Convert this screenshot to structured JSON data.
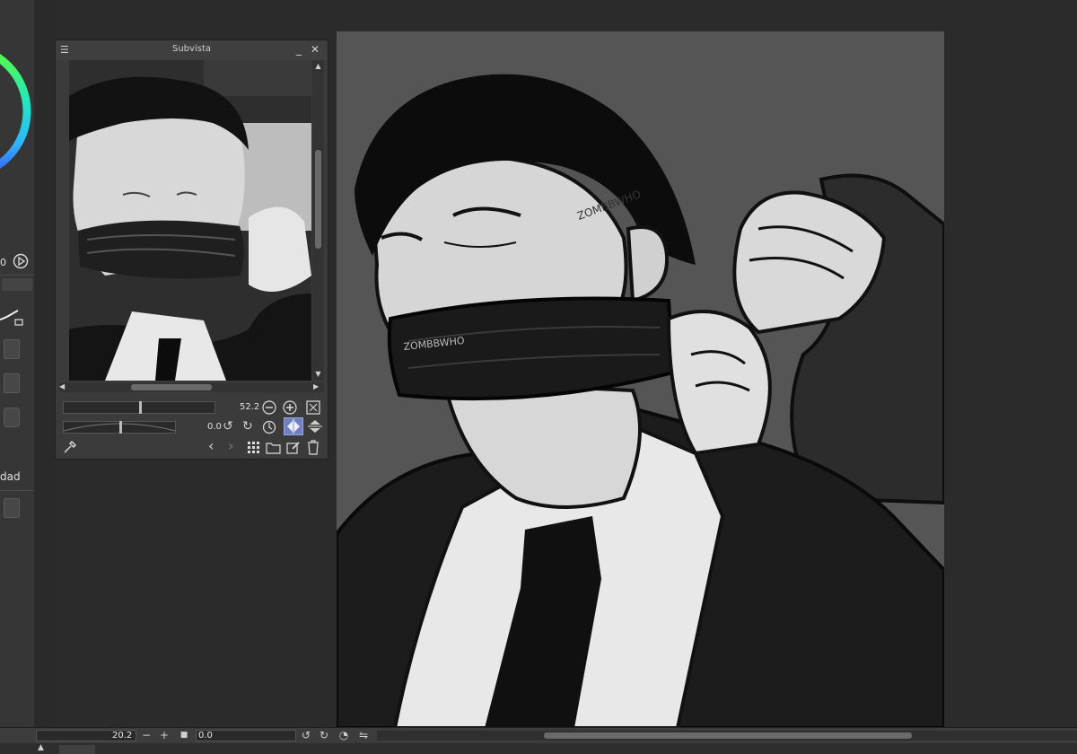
{
  "subview": {
    "title": "Subvista",
    "zoom_value": "52.2",
    "rotation_value": "0.0"
  },
  "left_panel": {
    "value_partial": "0",
    "label_partial": "dad"
  },
  "navigator": {
    "zoom_value": "20.2",
    "rotation_value": "0.0"
  },
  "canvas_art": {
    "watermark_face": "ZOMBBWHO",
    "watermark_gag": "ZOMBBWHO"
  },
  "colors": {
    "ui_dark": "#2b2b2b",
    "panel": "#3b3b3b",
    "canvas_bg": "#555555",
    "highlight_toggle": "#6f7fbf"
  },
  "icons": [
    "menu-icon",
    "minimize-icon",
    "close-icon",
    "zoom-out-icon",
    "zoom-in-icon",
    "fit-window-icon",
    "rotate-left-icon",
    "rotate-right-icon",
    "reset-rotation-icon",
    "flip-horizontal-icon",
    "flip-vertical-icon",
    "eyedropper-icon",
    "previous-icon",
    "next-icon",
    "grid-view-icon",
    "open-folder-icon",
    "edit-icon",
    "trash-icon",
    "play-icon",
    "lock-icon",
    "checkbox-icon"
  ]
}
